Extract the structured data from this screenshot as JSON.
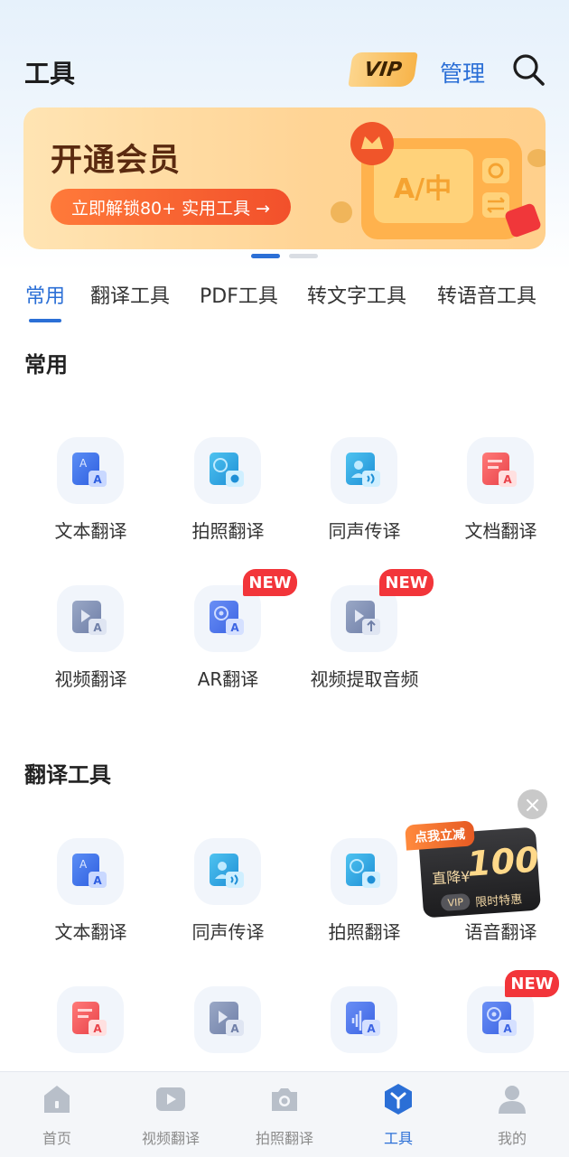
{
  "header": {
    "title": "工具",
    "vip_label": "VIP",
    "manage_label": "管理"
  },
  "banner": {
    "title": "开通会员",
    "cta": "立即解锁80+ 实用工具 →",
    "art_text": "A/中"
  },
  "tabs": [
    {
      "label": "常用",
      "active": true
    },
    {
      "label": "翻译工具",
      "active": false
    },
    {
      "label": "PDF工具",
      "active": false
    },
    {
      "label": "转文字工具",
      "active": false
    },
    {
      "label": "转语音工具",
      "active": false
    }
  ],
  "sections": {
    "common": {
      "title": "常用",
      "tools": [
        {
          "label": "文本翻译",
          "icon": "text-translate-icon"
        },
        {
          "label": "拍照翻译",
          "icon": "photo-translate-icon"
        },
        {
          "label": "同声传译",
          "icon": "simultaneous-interpretation-icon"
        },
        {
          "label": "文档翻译",
          "icon": "document-translate-icon"
        },
        {
          "label": "视频翻译",
          "icon": "video-translate-icon"
        },
        {
          "label": "AR翻译",
          "icon": "ar-translate-icon",
          "badge": "NEW"
        },
        {
          "label": "视频提取音频",
          "icon": "video-extract-audio-icon",
          "badge": "NEW"
        }
      ]
    },
    "translate": {
      "title": "翻译工具",
      "tools": [
        {
          "label": "文本翻译",
          "icon": "text-translate-icon"
        },
        {
          "label": "同声传译",
          "icon": "simultaneous-interpretation-icon"
        },
        {
          "label": "拍照翻译",
          "icon": "photo-translate-icon"
        },
        {
          "label": "语音翻译",
          "icon": "voice-translate-icon"
        }
      ],
      "row2_badge": "NEW"
    }
  },
  "promo": {
    "tag": "点我立减",
    "prefix": "直降¥",
    "amount": "100",
    "vip": "VIP",
    "subtitle": "限时特惠"
  },
  "bottom_nav": [
    {
      "label": "首页",
      "active": false
    },
    {
      "label": "视频翻译",
      "active": false
    },
    {
      "label": "拍照翻译",
      "active": false
    },
    {
      "label": "工具",
      "active": true
    },
    {
      "label": "我的",
      "active": false
    }
  ],
  "colors": {
    "accent": "#2b6fd6",
    "new_badge": "#f2353a",
    "banner_cta": "#f2502b"
  }
}
